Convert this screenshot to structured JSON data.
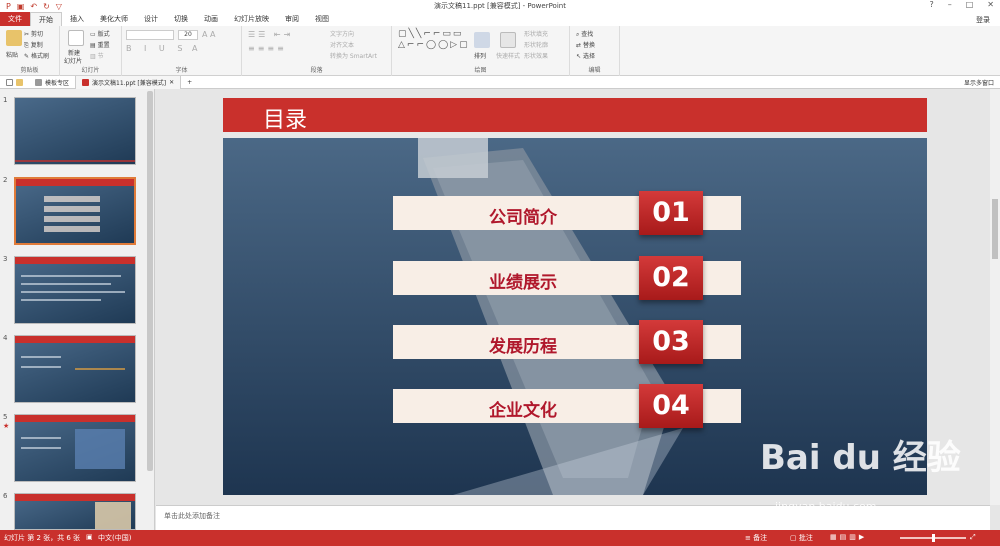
{
  "window": {
    "title": "演示文稿11.ppt [兼容模式] - PowerPoint",
    "min": "–",
    "max": "□",
    "close": "✕",
    "help": "?"
  },
  "quick_access": [
    "P",
    "▣",
    "↶",
    "↻",
    "▽"
  ],
  "tabs": [
    "文件",
    "开始",
    "插入",
    "美化大师",
    "设计",
    "切换",
    "动画",
    "幻灯片放映",
    "审阅",
    "视图"
  ],
  "active_tab": "开始",
  "account": "登录",
  "ribbon": {
    "clipboard": {
      "paste": "粘贴",
      "cut": "剪切",
      "copy": "复制",
      "format_painter": "格式刷",
      "group": "剪贴板"
    },
    "slides": {
      "new_slide": "新建",
      "new_slide2": "幻灯片",
      "layout": "版式",
      "reset": "重置",
      "section": "节",
      "group": "幻灯片"
    },
    "font": {
      "font_name": "",
      "font_size": "20",
      "group": "字体"
    },
    "paragraph": {
      "text_direction": "文字方向",
      "align_text": "对齐文本",
      "convert_smartart": "转换为 SmartArt",
      "group": "段落"
    },
    "drawing": {
      "arrange": "排列",
      "quick_styles": "快速样式",
      "shape_fill": "形状填充",
      "shape_outline": "形状轮廓",
      "shape_effects": "形状效果",
      "group": "绘图"
    },
    "editing": {
      "find": "查找",
      "replace": "替换",
      "select": "选择",
      "group": "编辑"
    }
  },
  "doc_tabs": [
    {
      "label": "模板专区"
    },
    {
      "label": "演示文稿11.ppt [兼容模式]"
    }
  ],
  "doc_tab_add": "+",
  "show_more_windows": "显示多窗口",
  "thumbnails": [
    {
      "num": "1",
      "star": ""
    },
    {
      "num": "2",
      "star": ""
    },
    {
      "num": "3",
      "star": ""
    },
    {
      "num": "4",
      "star": ""
    },
    {
      "num": "5",
      "star": "★"
    },
    {
      "num": "6",
      "star": ""
    }
  ],
  "slide": {
    "title": "目录",
    "items": [
      {
        "label": "公司简介",
        "num": "01"
      },
      {
        "label": "业绩展示",
        "num": "02"
      },
      {
        "label": "发展历程",
        "num": "03"
      },
      {
        "label": "企业文化",
        "num": "04"
      }
    ]
  },
  "notes_placeholder": "单击此处添加备注",
  "status": {
    "slide_info": "幻灯片 第 2 张，共 6 张",
    "language": "中文(中国)",
    "notes": "备注",
    "comments": "批注"
  },
  "watermark": {
    "logo": "Bai du 经验",
    "url": "jingyan.baidu.com"
  }
}
